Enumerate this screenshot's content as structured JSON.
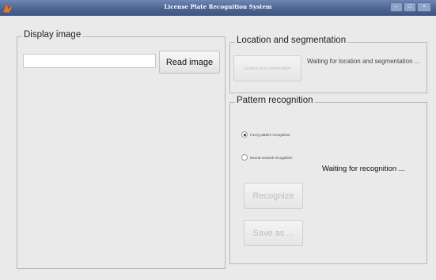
{
  "window": {
    "title": "License Plate Recognition System",
    "icon": "matlab-icon"
  },
  "display_panel": {
    "legend": "Display image",
    "path_value": "",
    "read_button": "Read image"
  },
  "location_panel": {
    "legend": "Location and segmentation",
    "button_label": "Location and segmentation",
    "status": "Waiting for location and segmentation ..."
  },
  "recognition_panel": {
    "legend": "Pattern recognition",
    "options": [
      {
        "label": "Fuzzy pattern recognition",
        "selected": true
      },
      {
        "label": "Neural network recognition",
        "selected": false
      }
    ],
    "status": "Waiting for recognition ...",
    "recognize_button": "Recognize",
    "save_button": "Save as ..."
  }
}
